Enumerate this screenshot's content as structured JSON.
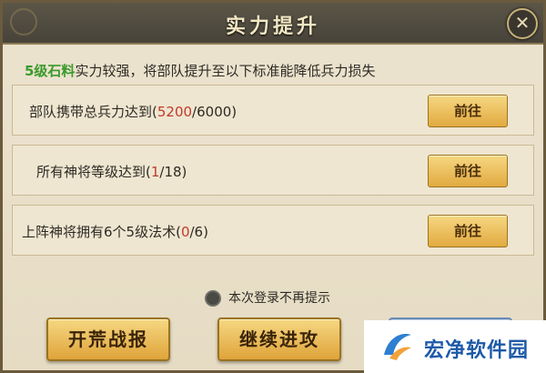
{
  "dialog": {
    "title": "实力提升",
    "close_icon": "close-icon"
  },
  "intro": {
    "highlight": "5级石料",
    "text": "实力较强，将部队提升至以下标准能降低兵力损失"
  },
  "requirements": [
    {
      "label": "部队携带总兵力达到(",
      "current": "5200",
      "rest": "/6000)",
      "button": "前往"
    },
    {
      "label": "所有神将等级达到(",
      "current": "1",
      "rest": "/18)",
      "button": "前往"
    },
    {
      "label": "上阵神将拥有6个5级法术(",
      "current": "0",
      "rest": "/6)",
      "button": "前往"
    }
  ],
  "no_remind": "本次登录不再提示",
  "buttons": {
    "report": "开荒战报",
    "continue": "继续进攻"
  },
  "watermark": {
    "text": "宏净软件园"
  },
  "colors": {
    "highlight_green": "#3a9a2b",
    "progress_red": "#c0392b",
    "button_gold": "#e2aa40"
  }
}
